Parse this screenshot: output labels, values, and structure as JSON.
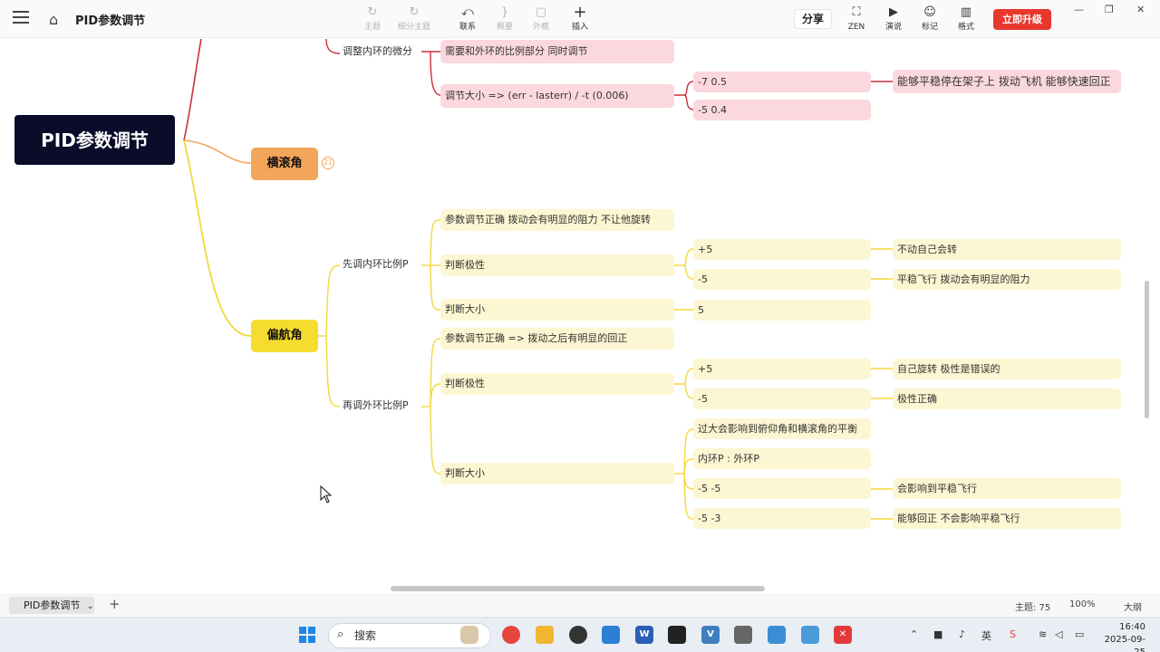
{
  "header": {
    "doc_title": "PID参数调节",
    "tools": [
      {
        "label": "主题",
        "icon": "↻"
      },
      {
        "label": "细分主题",
        "icon": "↻"
      },
      {
        "label": "联系",
        "icon": "⤺"
      },
      {
        "label": "概要",
        "icon": "}"
      },
      {
        "label": "外框",
        "icon": "▢"
      },
      {
        "label": "插入",
        "icon": "+"
      }
    ],
    "share": "分享",
    "right_tools": [
      {
        "label": "ZEN",
        "icon": "⛶"
      },
      {
        "label": "演说",
        "icon": "▶"
      },
      {
        "label": "标记",
        "icon": "☺"
      },
      {
        "label": "格式",
        "icon": "▥"
      }
    ],
    "upgrade": "立即升级",
    "window": {
      "minimize": "—",
      "maximize": "❐",
      "close": "✕"
    }
  },
  "mindmap": {
    "root": "PID参数调节",
    "roll": {
      "label": "横滚角",
      "badge": "21"
    },
    "yaw": {
      "label": "偏航角"
    },
    "pink_nodes": {
      "adjust_inner_d": "调整内环的微分",
      "with_outer_p": "需要和外环的比例部分 同时调节",
      "adjust_size": "调节大小  => (err - lasterr) /  -t (0.006)",
      "val1": "-7   0.5",
      "val2": "-5   0.4",
      "result1": "能够平稳停在架子上 拨动飞机 能够快速回正"
    },
    "yellow_nodes": {
      "inner_p": "先调内环比例P",
      "param_ok1": "参数调节正确  拨动会有明显的阻力 不让他旋转",
      "polarity1": "判断极性",
      "p1_plus": "+5",
      "p1_plus_res": "不动自己会转",
      "p1_minus": "-5",
      "p1_minus_res": "平稳飞行  拨动会有明显的阻力",
      "size1": "判断大小",
      "size1_val": "5",
      "outer_p": "再调外环比例P",
      "param_ok2": "参数调节正确 => 拨动之后有明显的回正",
      "polarity2": "判断极性",
      "p2_plus": "+5",
      "p2_plus_res": "自己旋转  极性是错误的",
      "p2_minus": "-5",
      "p2_minus_res": "极性正确",
      "size2": "判断大小",
      "s2_a": "过大会影响到俯仰角和横滚角的平衡",
      "s2_b": "内环P : 外环P",
      "s2_c": "-5 -5",
      "s2_c_res": "会影响到平稳飞行",
      "s2_d": "-5 -3",
      "s2_d_res": "能够回正 不会影响平稳飞行"
    }
  },
  "sheetbar": {
    "tab": "PID参数调节",
    "topics": "主题: 75",
    "zoom": "100%",
    "outline": "大纲"
  },
  "taskbar": {
    "search": "搜索",
    "time": "16:40",
    "date": "2025-09-25",
    "ime": "英"
  }
}
